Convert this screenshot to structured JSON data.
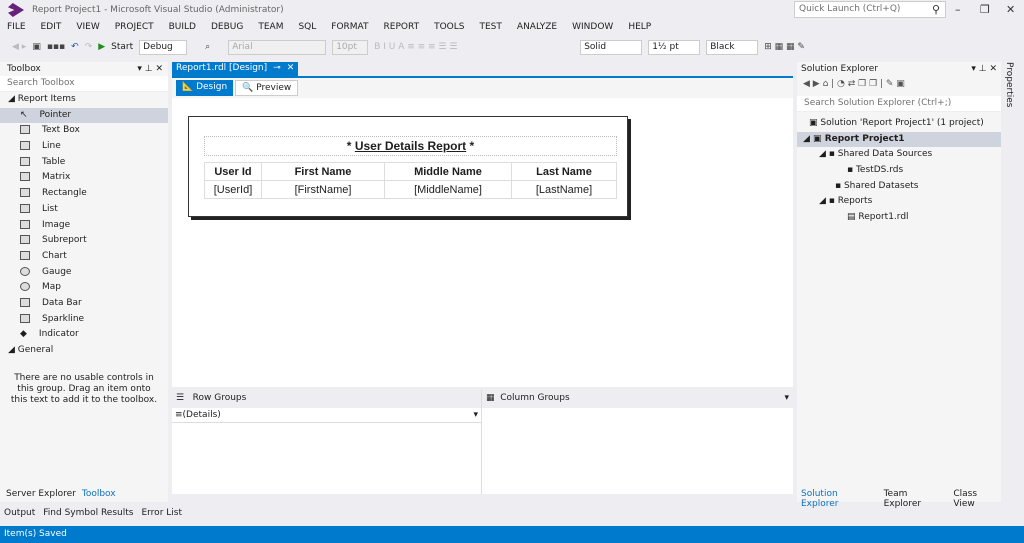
{
  "window": {
    "title": "Report Project1 - Microsoft Visual Studio (Administrator)",
    "quick_launch": "Quick Launch (Ctrl+Q)"
  },
  "menu": [
    "FILE",
    "EDIT",
    "VIEW",
    "PROJECT",
    "BUILD",
    "DEBUG",
    "TEAM",
    "SQL",
    "FORMAT",
    "REPORT",
    "TOOLS",
    "TEST",
    "ANALYZE",
    "WINDOW",
    "HELP"
  ],
  "toolbar": {
    "start": "Start",
    "config": "Debug",
    "font": "Arial",
    "size": "10pt",
    "border_style": "Solid",
    "border_width": "1½ pt",
    "border_color": "Black"
  },
  "toolbox": {
    "title": "Toolbox",
    "search_placeholder": "Search Toolbox",
    "group1": "Report Items",
    "items": [
      "Pointer",
      "Text Box",
      "Line",
      "Table",
      "Matrix",
      "Rectangle",
      "List",
      "Image",
      "Subreport",
      "Chart",
      "Gauge",
      "Map",
      "Data Bar",
      "Sparkline",
      "Indicator"
    ],
    "group2": "General",
    "empty_msg": "There are no usable controls in this group. Drag an item onto this text to add it to the toolbox.",
    "tabs": [
      "Server Explorer",
      "Toolbox"
    ]
  },
  "document": {
    "tab": "Report1.rdl [Design]",
    "design": "Design",
    "preview": "Preview"
  },
  "report": {
    "title": "User Details Report",
    "headers": [
      "User Id",
      "First Name",
      "Middle Name",
      "Last Name"
    ],
    "fields": [
      "[UserId]",
      "[FirstName]",
      "[MiddleName]",
      "[LastName]"
    ]
  },
  "groups": {
    "row": "Row Groups",
    "column": "Column Groups",
    "details": "(Details)"
  },
  "solution": {
    "title": "Solution Explorer",
    "search_placeholder": "Search Solution Explorer (Ctrl+;)",
    "tree": [
      "Solution 'Report Project1' (1 project)",
      "Report Project1",
      "Shared Data Sources",
      "TestDS.rds",
      "Shared Datasets",
      "Reports",
      "Report1.rdl"
    ],
    "tabs": [
      "Solution Explorer",
      "Team Explorer",
      "Class View"
    ]
  },
  "properties_tab": "Properties",
  "bottom_tabs": [
    "Output",
    "Find Symbol Results",
    "Error List"
  ],
  "status": "Item(s) Saved",
  "colors": {
    "accent": "#007acc",
    "selection": "#cfd3dd"
  }
}
